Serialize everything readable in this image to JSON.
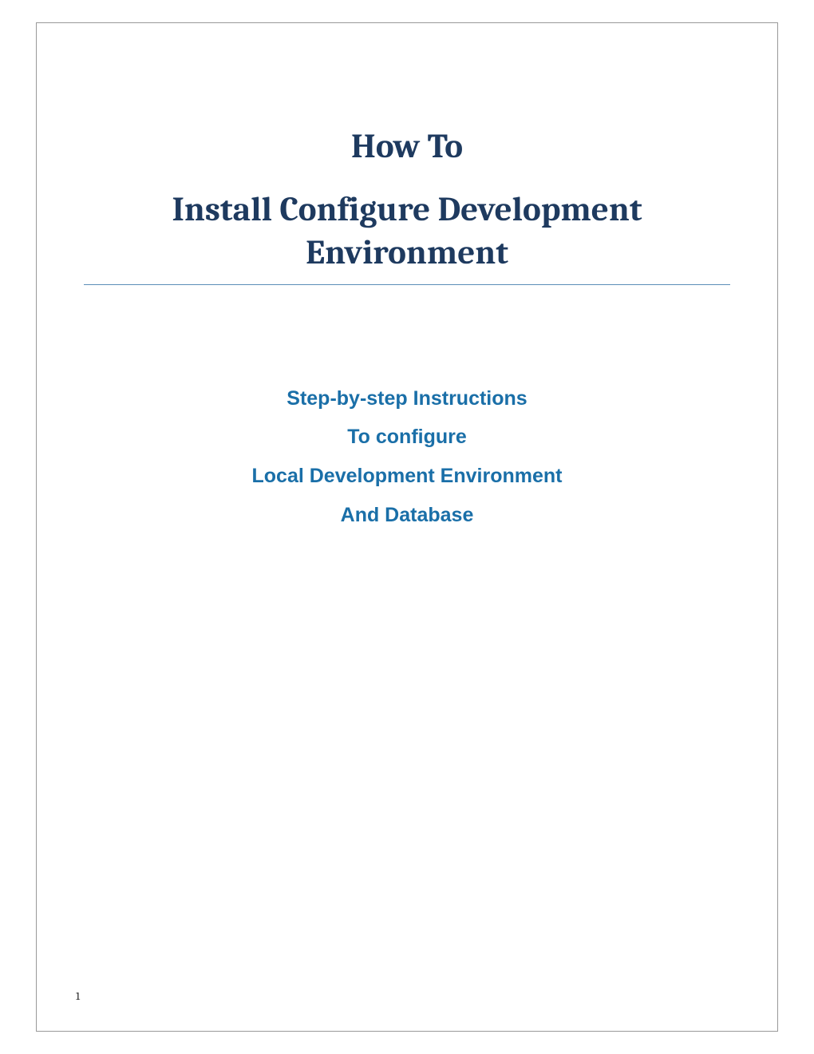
{
  "title": {
    "line1": "How To",
    "line2": "Install Configure Development Environment"
  },
  "subtitle": {
    "line1": "Step-by-step Instructions",
    "line2": "To configure",
    "line3": "Local Development Environment",
    "line4": "And Database"
  },
  "footer": {
    "page_number": "1"
  }
}
